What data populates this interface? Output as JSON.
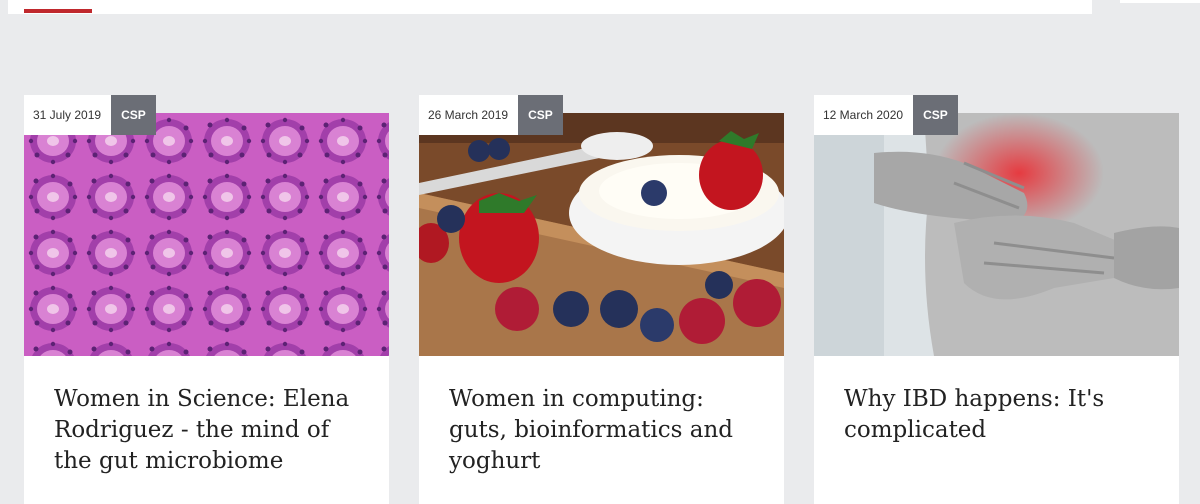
{
  "cards": [
    {
      "date": "31 July 2019",
      "tag": "CSP",
      "title": "Women in Science: Elena Rodriguez - the mind of the gut microbiome",
      "image": "histology-tissue-image"
    },
    {
      "date": "26 March 2019",
      "tag": "CSP",
      "title": "Women in computing: guts, bioinformatics and yoghurt",
      "image": "yoghurt-berries-image"
    },
    {
      "date": "12 March 2020",
      "tag": "CSP",
      "title": "Why IBD happens: It's complicated",
      "image": "abdominal-pain-image"
    }
  ],
  "colors": {
    "accent": "#c0282d",
    "tag_background": "#6b6e76",
    "page_background": "#eaebed"
  }
}
